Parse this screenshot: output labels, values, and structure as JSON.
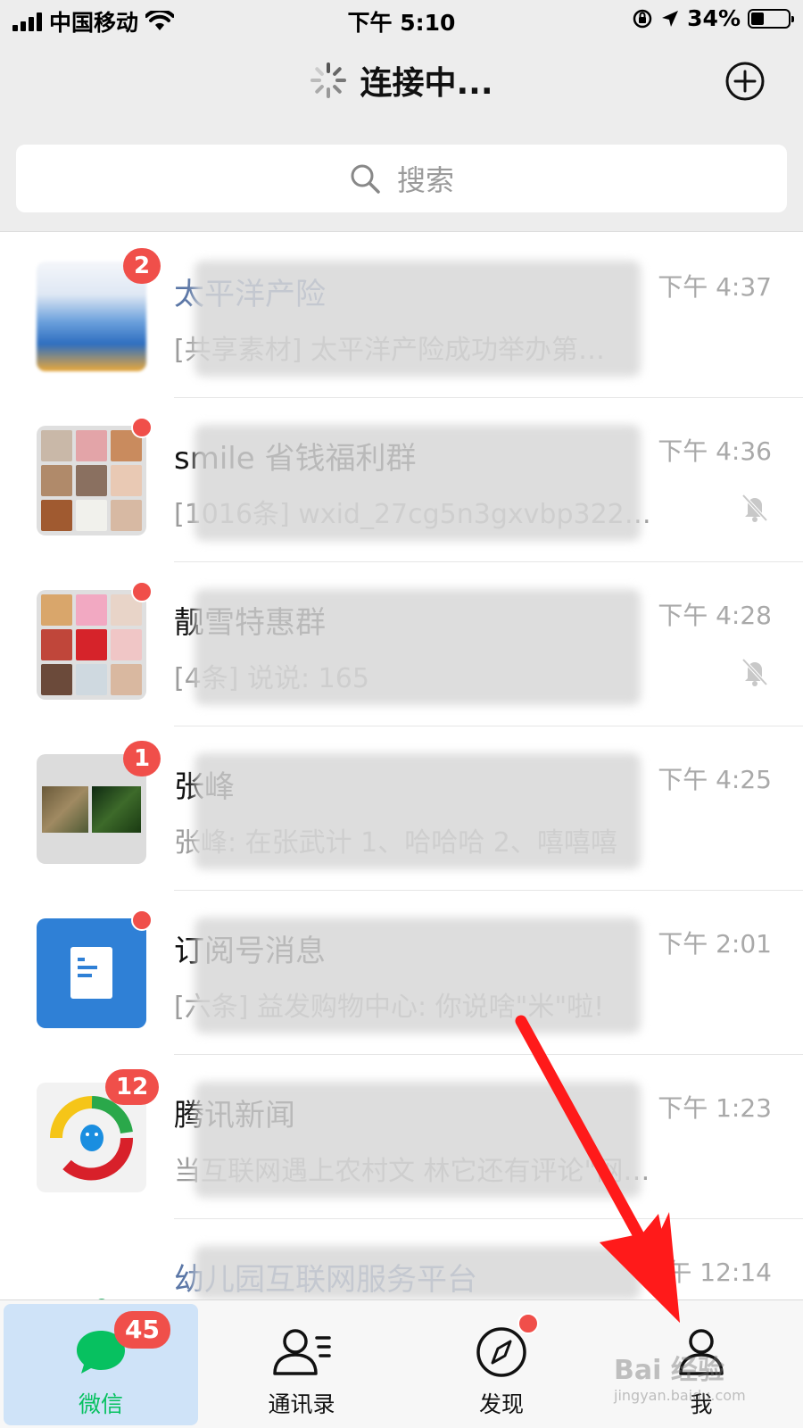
{
  "status_bar": {
    "carrier": "中国移动",
    "time": "下午 5:10",
    "battery": "34%",
    "battery_level": 0.34
  },
  "header": {
    "title": "连接中...",
    "add_icon": "plus-circle-icon"
  },
  "search": {
    "placeholder": "搜索"
  },
  "chats": [
    {
      "name": "太平洋产险",
      "preview": "[共享素材] 太平洋产险成功举办第…",
      "time": "下午 4:37",
      "badge": "2",
      "muted": false,
      "avatar": "blurred-image"
    },
    {
      "name": "smile 省钱福利群",
      "preview": "[1016条] wxid_27cg5n3gxvbp322…",
      "time": "下午 4:36",
      "badge": "",
      "dot": true,
      "muted": true,
      "avatar": "group-grid"
    },
    {
      "name": "靓雪特惠群",
      "preview": "[4条] 说说: 165",
      "time": "下午 4:28",
      "badge": "",
      "dot": true,
      "muted": true,
      "avatar": "group-grid"
    },
    {
      "name": "张峰",
      "preview": "张峰: 在张武计 1、哈哈哈 2、嘻嘻嘻",
      "time": "下午 4:25",
      "badge": "1",
      "muted": false,
      "avatar": "photo-pair"
    },
    {
      "name": "订阅号消息",
      "preview": "[六条] 益发购物中心: 你说啥\"米\"啦!",
      "time": "下午 2:01",
      "badge": "",
      "dot": true,
      "muted": false,
      "avatar": "document-icon"
    },
    {
      "name": "腾讯新闻",
      "preview": "当互联网遇上农村文 林它还有评论\"网…",
      "time": "下午 1:23",
      "badge": "12",
      "muted": false,
      "avatar": "tencent-news-logo"
    },
    {
      "name": "幼儿园互联网服务平台",
      "preview": "",
      "time": "下午 12:14",
      "badge": "",
      "muted": false,
      "avatar": "color-bars-logo"
    }
  ],
  "tabs": [
    {
      "label": "微信",
      "badge": "45",
      "icon": "chat-bubble-icon",
      "active": true
    },
    {
      "label": "通讯录",
      "icon": "contacts-icon",
      "active": false
    },
    {
      "label": "发现",
      "icon": "compass-icon",
      "active": false,
      "dot": true
    },
    {
      "label": "我",
      "icon": "person-icon",
      "active": false
    }
  ],
  "watermark": {
    "text": "Bai 经验",
    "subtext": "jingyan.baidu.com"
  },
  "colors": {
    "accent_green": "#07c160",
    "badge_red": "#f04f4a",
    "header_bg": "#ededed",
    "arrow_red": "#ff1a1a"
  }
}
